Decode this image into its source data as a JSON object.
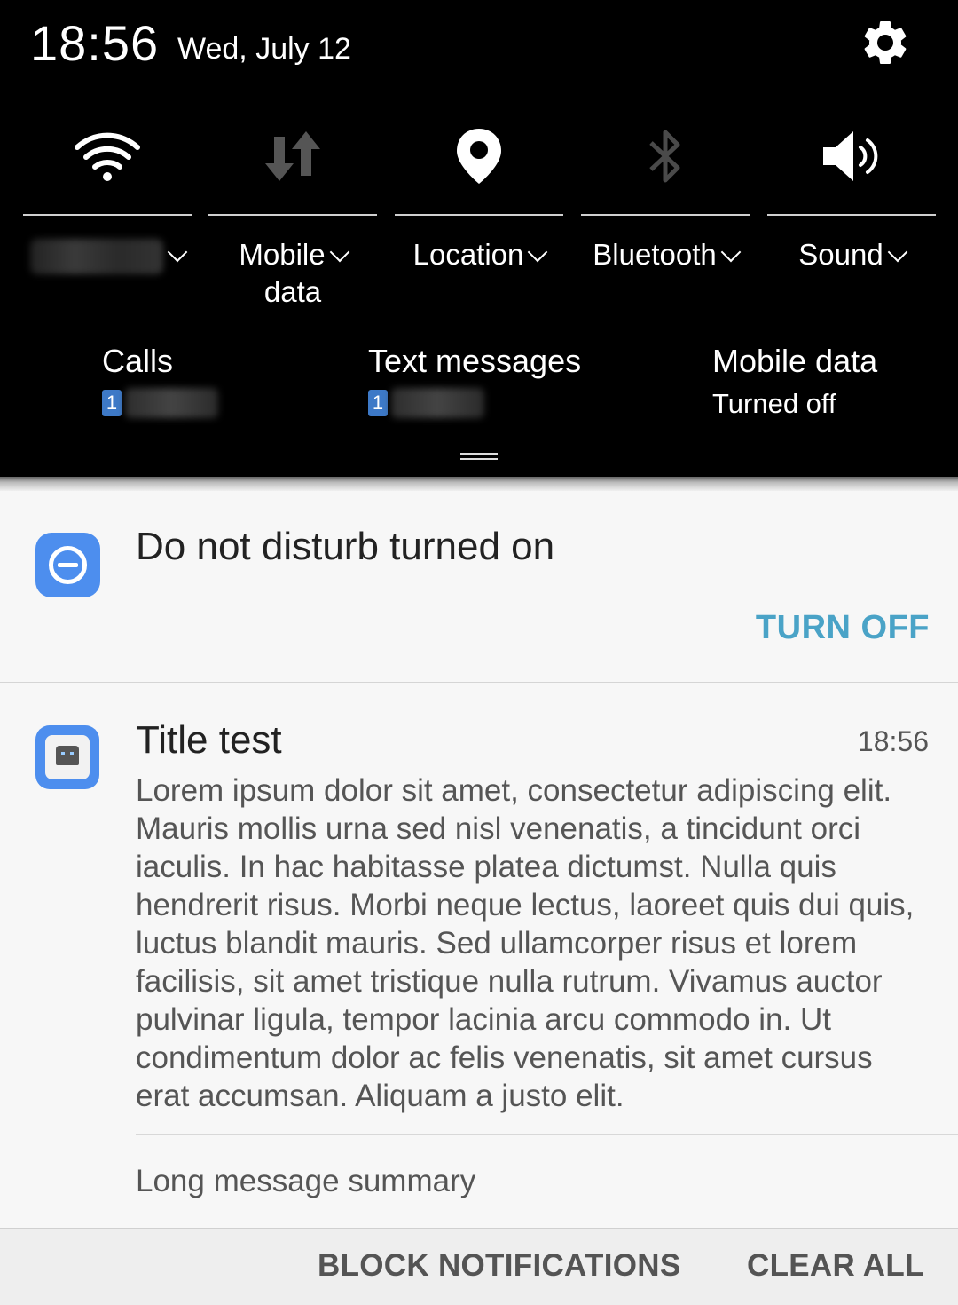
{
  "status": {
    "time": "18:56",
    "date": "Wed, July 12"
  },
  "quick_settings": {
    "tiles": [
      {
        "id": "wifi",
        "icon": "wifi-icon",
        "label": "",
        "label_line2": ""
      },
      {
        "id": "mobile-data",
        "icon": "mobile-data-icon",
        "label": "Mobile",
        "label_line2": "data"
      },
      {
        "id": "location",
        "icon": "location-pin-icon",
        "label": "Location",
        "label_line2": ""
      },
      {
        "id": "bluetooth",
        "icon": "bluetooth-icon",
        "label": "Bluetooth",
        "label_line2": ""
      },
      {
        "id": "sound",
        "icon": "speaker-icon",
        "label": "Sound",
        "label_line2": ""
      }
    ]
  },
  "sim_info": {
    "calls": {
      "title": "Calls",
      "sim": "1"
    },
    "texts": {
      "title": "Text messages",
      "sim": "1"
    },
    "mobile_data": {
      "title": "Mobile data",
      "status": "Turned off"
    }
  },
  "notifications": {
    "dnd": {
      "text": "Do not disturb turned on",
      "action": "TURN OFF"
    },
    "app": {
      "title": "Title test",
      "time": "18:56",
      "body": "Lorem ipsum dolor sit amet, consectetur adipiscing elit. Mauris mollis urna sed nisl venenatis, a tincidunt orci iaculis. In hac habitasse platea dictumst. Nulla quis hendrerit risus. Morbi neque lectus, laoreet quis dui quis, luctus blandit mauris. Sed ullamcorper risus et lorem facilisis, sit amet tristique nulla rutrum. Vivamus auctor pulvinar ligula, tempor lacinia arcu commodo in. Ut condimentum dolor ac felis venenatis, sit amet cursus erat accumsan. Aliquam a justo elit.",
      "summary": "Long message summary"
    }
  },
  "footer": {
    "block": "BLOCK NOTIFICATIONS",
    "clear": "CLEAR ALL"
  },
  "colors": {
    "accent": "#4aa3c7",
    "icon_blue": "#4d8eee",
    "panel_bg": "#000000"
  }
}
